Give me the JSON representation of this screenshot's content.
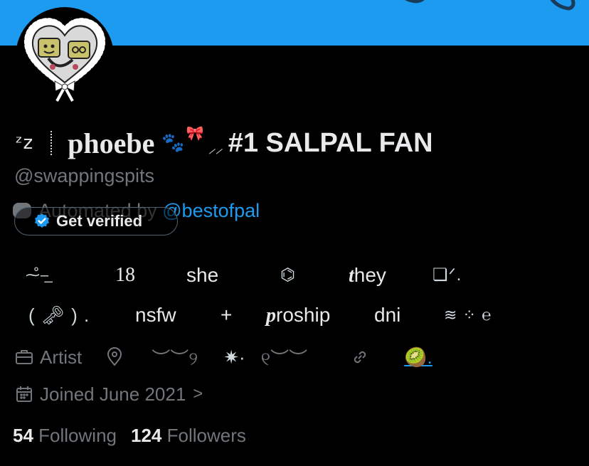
{
  "profile": {
    "name_prefix": "ᶻz",
    "display_name": "phoebe",
    "paw": "🐾",
    "bow": "🎀",
    "slashes": "⸝⸝",
    "fan_tag": "#1 SALPAL FAN",
    "handle": "@swappingspits"
  },
  "automated": {
    "label": "Automated by",
    "account": "@bestofpal"
  },
  "verified": {
    "label": "Get verified"
  },
  "bio": {
    "row1": [
      "18",
      "she",
      "they"
    ],
    "row1_deco_left": "⁓̊–̲",
    "row1_bone": "⌬",
    "row1_deco_right": "❏ᐟ.",
    "row2": [
      "nsfw",
      "+",
      "proship",
      "dni"
    ],
    "row2_key": "( 🗝 ) .",
    "row2_deco": "≋ ⁘ ℮"
  },
  "meta": {
    "profession": "Artist",
    "location": "︶︶୨",
    "sparkle": "✷·",
    "location2": "୧︶︶",
    "link": "🥝."
  },
  "joined": {
    "text": "Joined June 2021",
    "chevron": ">"
  },
  "stats": {
    "following_count": "54",
    "following_label": "Following",
    "followers_count": "124",
    "followers_label": "Followers"
  },
  "colors": {
    "banner": "#1d9bf0",
    "link": "#1d9bf0",
    "muted": "#71767b",
    "text": "#e7e9ea",
    "background": "#000000"
  }
}
